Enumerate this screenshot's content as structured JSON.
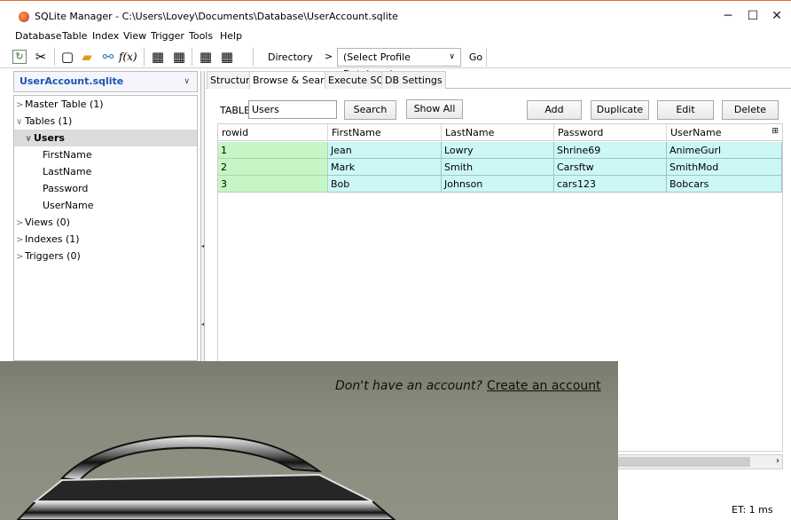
{
  "window": {
    "title": "SQLite Manager - C:\\Users\\Lovey\\Documents\\Database\\UserAccount.sqlite",
    "minimize": "─",
    "maximize": "☐",
    "close": "✕"
  },
  "menu": [
    "Database",
    "Table",
    "Index",
    "View",
    "Trigger",
    "Tools",
    "Help"
  ],
  "toolbar": {
    "directory_label": "Directory",
    "arrow": ">",
    "profile_select": "(Select Profile Database)",
    "go_label": "Go"
  },
  "sidebar": {
    "database": "UserAccount.sqlite",
    "tree": [
      {
        "label": "Master Table (1)",
        "caret": ">",
        "indent": 0,
        "selected": false
      },
      {
        "label": "Tables (1)",
        "caret": "∨",
        "indent": 0,
        "selected": false
      },
      {
        "label": "Users",
        "caret": "∨",
        "indent": 1,
        "selected": true
      },
      {
        "label": "FirstName",
        "caret": "",
        "indent": 2,
        "selected": false
      },
      {
        "label": "LastName",
        "caret": "",
        "indent": 2,
        "selected": false
      },
      {
        "label": "Password",
        "caret": "",
        "indent": 2,
        "selected": false
      },
      {
        "label": "UserName",
        "caret": "",
        "indent": 2,
        "selected": false
      },
      {
        "label": "Views (0)",
        "caret": ">",
        "indent": 0,
        "selected": false
      },
      {
        "label": "Indexes (1)",
        "caret": ">",
        "indent": 0,
        "selected": false
      },
      {
        "label": "Triggers (0)",
        "caret": ">",
        "indent": 0,
        "selected": false
      }
    ]
  },
  "tabs": [
    {
      "label": "Structure",
      "active": false
    },
    {
      "label": "Browse & Search",
      "active": true
    },
    {
      "label": "Execute SQL",
      "active": false
    },
    {
      "label": "DB Settings",
      "active": false
    }
  ],
  "browse": {
    "table_label": "TABLE",
    "table_value": "Users",
    "search_label": "Search",
    "show_all_label": "Show All",
    "add_label": "Add",
    "duplicate_label": "Duplicate",
    "edit_label": "Edit",
    "delete_label": "Delete"
  },
  "grid": {
    "columns": [
      "rowid",
      "FirstName",
      "LastName",
      "Password",
      "UserName"
    ],
    "rows": [
      [
        "1",
        "Jean",
        "Lowry",
        "Shrine69",
        "AnimeGurl"
      ],
      [
        "2",
        "Mark",
        "Smith",
        "Carsftw",
        "SmithMod"
      ],
      [
        "3",
        "Bob",
        "Johnson",
        "cars123",
        "Bobcars"
      ]
    ]
  },
  "status": {
    "elapsed": "ET: 1 ms"
  },
  "overlay": {
    "prompt": "Don't have an account?",
    "create_link": "Create an account"
  }
}
